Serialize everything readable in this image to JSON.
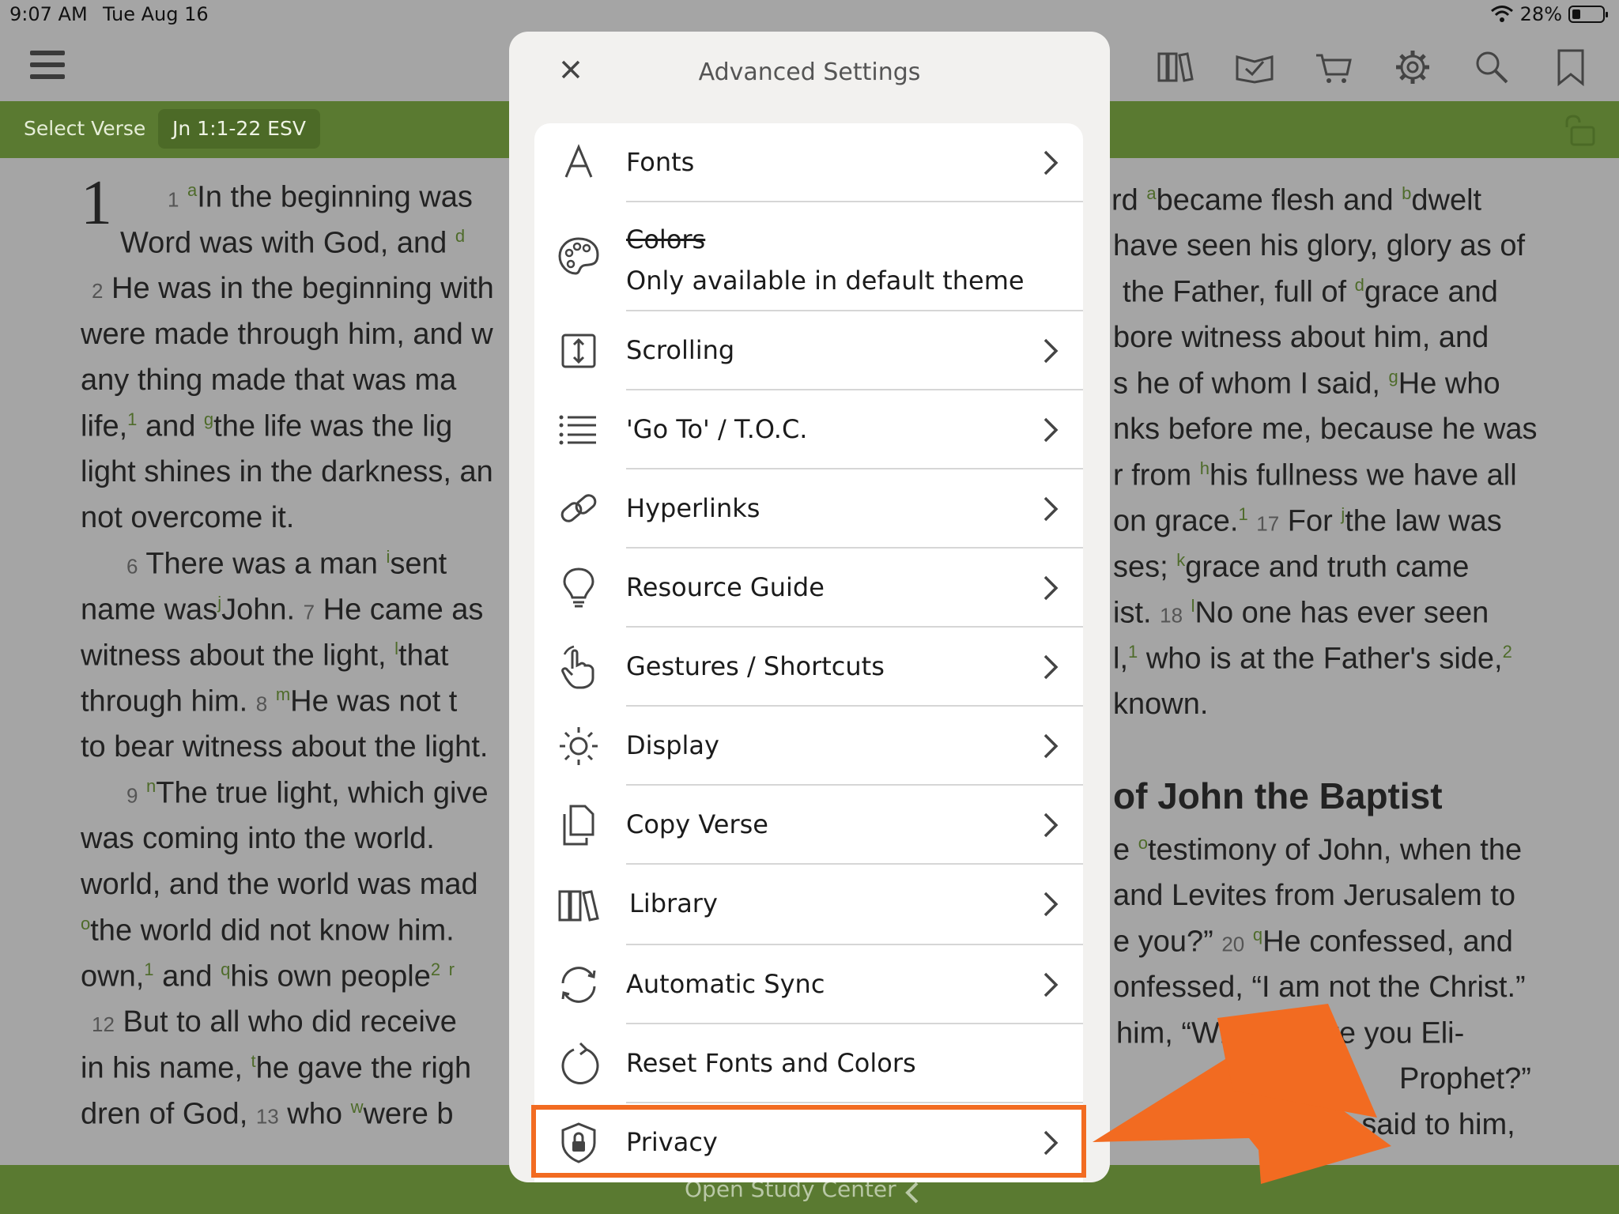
{
  "status_bar": {
    "time": "9:07 AM",
    "date": "Tue Aug 16",
    "battery": "28%"
  },
  "toolbar": {
    "icons": [
      "library-icon",
      "reading-plans-icon",
      "cart-icon",
      "settings-icon",
      "search-icon",
      "bookmark-icon"
    ]
  },
  "verse_bar": {
    "select_label": "Select Verse",
    "reference": "Jn 1:1-22 ESV"
  },
  "bottom_bar": {
    "label": "Open Study Center"
  },
  "scripture": {
    "chapter": "1",
    "section_heading": "of John the Baptist",
    "left_lines": [
      "Word was with God, and",
      "He was in the beginning with",
      "were made through him, and w",
      "any thing made that was ma",
      "and",
      "the life was the lig",
      "light shines in the darkness, an",
      "not overcome it.",
      "There was a man",
      "sent",
      "name was",
      "John.",
      "He came as",
      "witness about the light,",
      "that",
      "through him.",
      "He was not t",
      "to bear witness about the light.",
      "The true light, which give",
      "was coming into the world.",
      "world, and the world was mad",
      "the world did not know him.",
      "own,",
      "and",
      "his own people",
      "But to all who did receive",
      "in his name,",
      "he gave the righ",
      "dren of God,",
      "who",
      "were b"
    ],
    "right_lines": [
      "rd",
      "became flesh and",
      "dwelt",
      "have seen his glory, glory as of",
      "the Father, full of",
      "grace and",
      "bore witness about him, and",
      "s he of whom I said,",
      "He who",
      "nks before me, because he was",
      "r from",
      "his fullness we have all",
      "on grace.",
      "For",
      "the law was",
      "ses;",
      "grace and truth came",
      "ist.",
      "No one has ever seen",
      "who is at the Father's side,",
      "known.",
      "testimony of John, when the",
      "and Levites from Jerusalem to",
      "you?”",
      "He confessed, and",
      "onfessed, “I am not the Christ.”",
      "him, “What th",
      "Are you Eli-",
      "Prophet?”",
      "they said to him,"
    ],
    "first_verse_left": "In the beginning was",
    "first_line_right": "rd",
    "verse_numbers": [
      "1",
      "2",
      "6",
      "7",
      "8",
      "9",
      "12",
      "13",
      "17",
      "18",
      "20"
    ],
    "footnote_letters": [
      "a",
      "b",
      "d",
      "g",
      "i",
      "j",
      "l",
      "m",
      "n",
      "o",
      "q",
      "r",
      "t",
      "w",
      "h",
      "k",
      "j",
      "l",
      "b",
      "a",
      "g",
      "d",
      "o",
      "q"
    ]
  },
  "modal": {
    "title": "Advanced Settings",
    "items": [
      {
        "label": "Fonts",
        "icon": "font-icon"
      },
      {
        "label": "Colors",
        "sublabel": "Only available in default theme",
        "icon": "palette-icon",
        "disabled": true
      },
      {
        "label": "Scrolling",
        "icon": "scroll-icon"
      },
      {
        "label": "'Go To' / T.O.C.",
        "icon": "list-icon"
      },
      {
        "label": "Hyperlinks",
        "icon": "link-icon"
      },
      {
        "label": "Resource Guide",
        "icon": "lightbulb-icon"
      },
      {
        "label": "Gestures / Shortcuts",
        "icon": "gesture-hand-icon"
      },
      {
        "label": "Display",
        "icon": "brightness-icon"
      },
      {
        "label": "Copy Verse",
        "icon": "copy-icon"
      },
      {
        "label": "Library",
        "icon": "library-icon"
      },
      {
        "label": "Automatic Sync",
        "icon": "sync-icon"
      },
      {
        "label": "Reset Fonts and Colors",
        "icon": "reset-icon"
      },
      {
        "label": "Privacy",
        "icon": "shield-lock-icon",
        "highlighted": true
      }
    ]
  },
  "colors": {
    "accent_green": "#5a7a31",
    "highlight_orange": "#f26b21"
  }
}
